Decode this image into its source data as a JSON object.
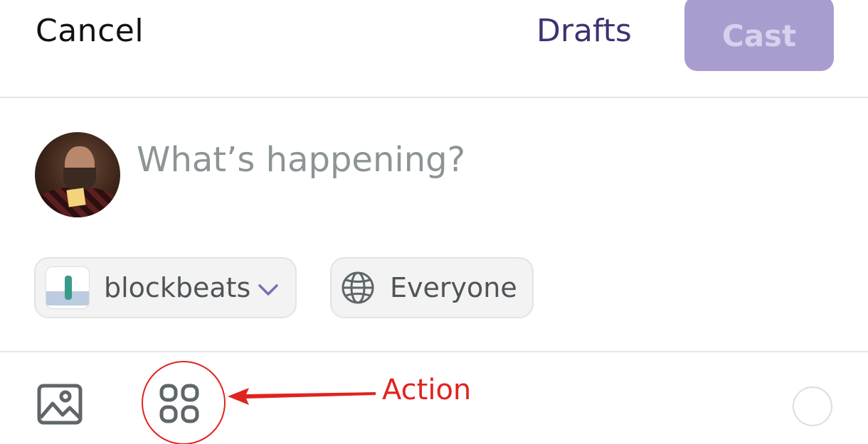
{
  "header": {
    "cancel_label": "Cancel",
    "drafts_label": "Drafts",
    "cast_label": "Cast"
  },
  "composer": {
    "placeholder": "What’s happening?"
  },
  "chips": {
    "channel_label": "blockbeats",
    "audience_label": "Everyone"
  },
  "annotation": {
    "action_label": "Action"
  },
  "colors": {
    "accent": "#a99dd0",
    "drafts": "#3b3470",
    "annotation": "#e0231f"
  }
}
